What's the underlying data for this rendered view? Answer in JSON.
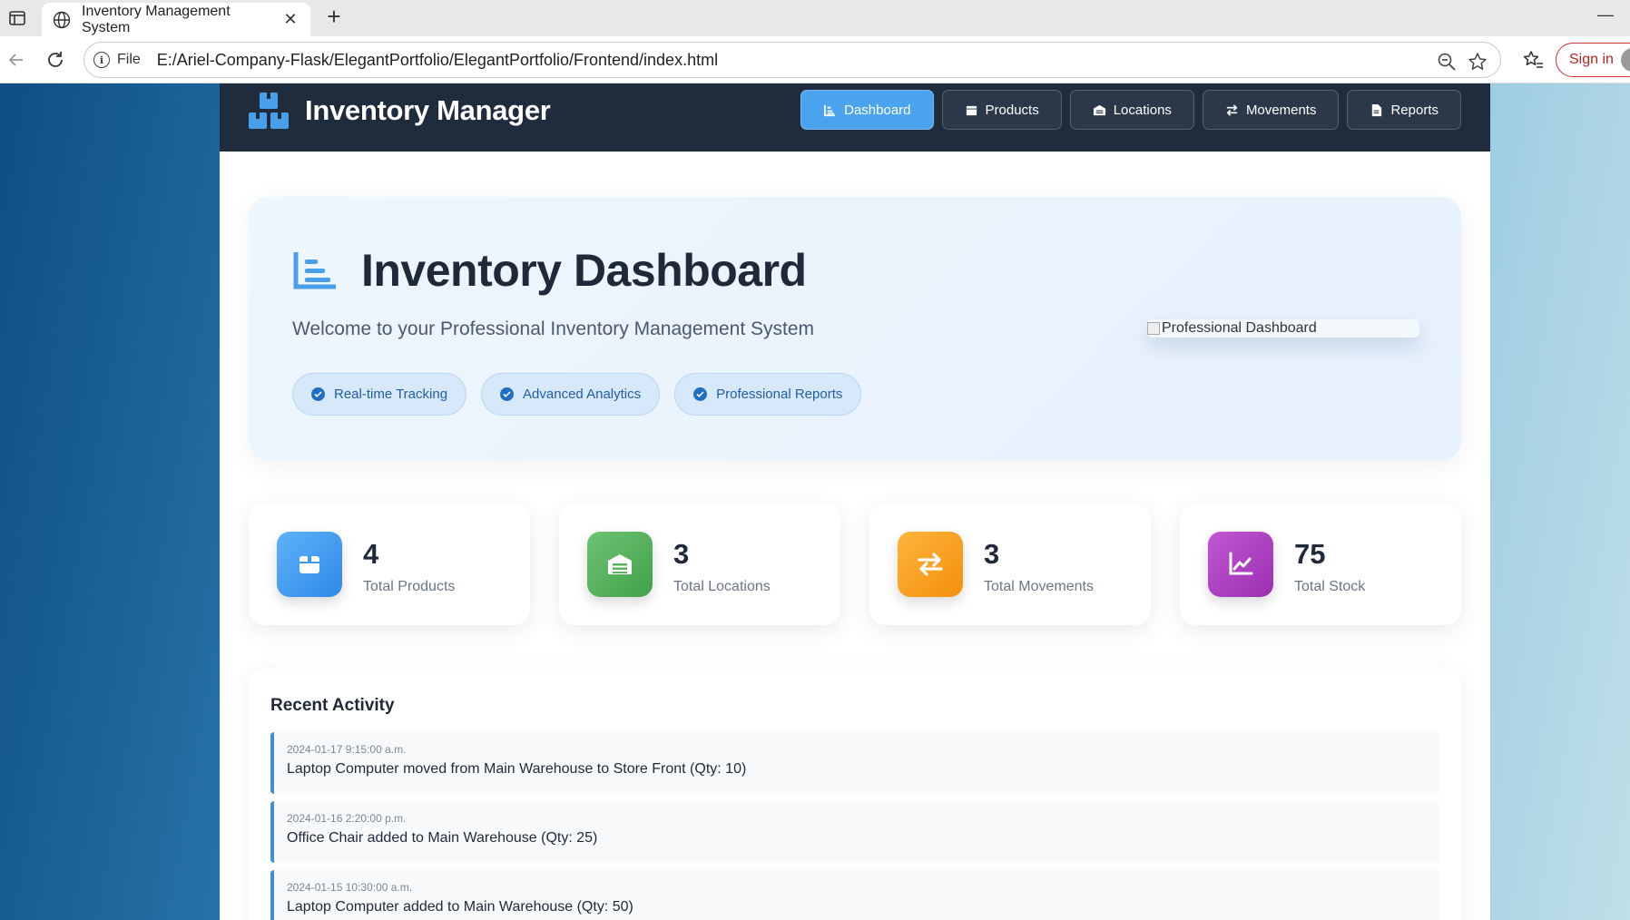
{
  "browser": {
    "tab_title": "Inventory Management System",
    "address_scheme_label": "File",
    "url": "E:/Ariel-Company-Flask/ElegantPortfolio/ElegantPortfolio/Frontend/index.html",
    "sign_in_label": "Sign in"
  },
  "header": {
    "brand_title": "Inventory Manager",
    "nav": [
      {
        "label": "Dashboard",
        "icon": "chart-icon",
        "active": true
      },
      {
        "label": "Products",
        "icon": "box-icon",
        "active": false
      },
      {
        "label": "Locations",
        "icon": "warehouse-icon",
        "active": false
      },
      {
        "label": "Movements",
        "icon": "exchange-icon",
        "active": false
      },
      {
        "label": "Reports",
        "icon": "file-icon",
        "active": false
      }
    ]
  },
  "hero": {
    "title": "Inventory Dashboard",
    "subtitle": "Welcome to your Professional Inventory Management System",
    "pills": [
      "Real-time Tracking",
      "Advanced Analytics",
      "Professional Reports"
    ],
    "image_alt": "Professional Dashboard"
  },
  "stats": [
    {
      "value": "4",
      "label": "Total Products",
      "icon": "box-icon",
      "color": "#3f9bf0"
    },
    {
      "value": "3",
      "label": "Total Locations",
      "icon": "warehouse-icon",
      "color": "#55b45c"
    },
    {
      "value": "3",
      "label": "Total Movements",
      "icon": "exchange-icon",
      "color": "#f9a01e"
    },
    {
      "value": "75",
      "label": "Total Stock",
      "icon": "line-chart-icon",
      "color": "#b044c2"
    }
  ],
  "activity": {
    "title": "Recent Activity",
    "items": [
      {
        "time": "2024-01-17 9:15:00 a.m.",
        "text": "Laptop Computer moved from Main Warehouse to Store Front (Qty: 10)"
      },
      {
        "time": "2024-01-16 2:20:00 p.m.",
        "text": "Office Chair added to Main Warehouse (Qty: 25)"
      },
      {
        "time": "2024-01-15 10:30:00 a.m.",
        "text": "Laptop Computer added to Main Warehouse (Qty: 50)"
      }
    ]
  },
  "colors": {
    "header_bg": "#1f2c3d",
    "accent": "#4aa3ee",
    "activity_border": "#3f8fd8"
  }
}
